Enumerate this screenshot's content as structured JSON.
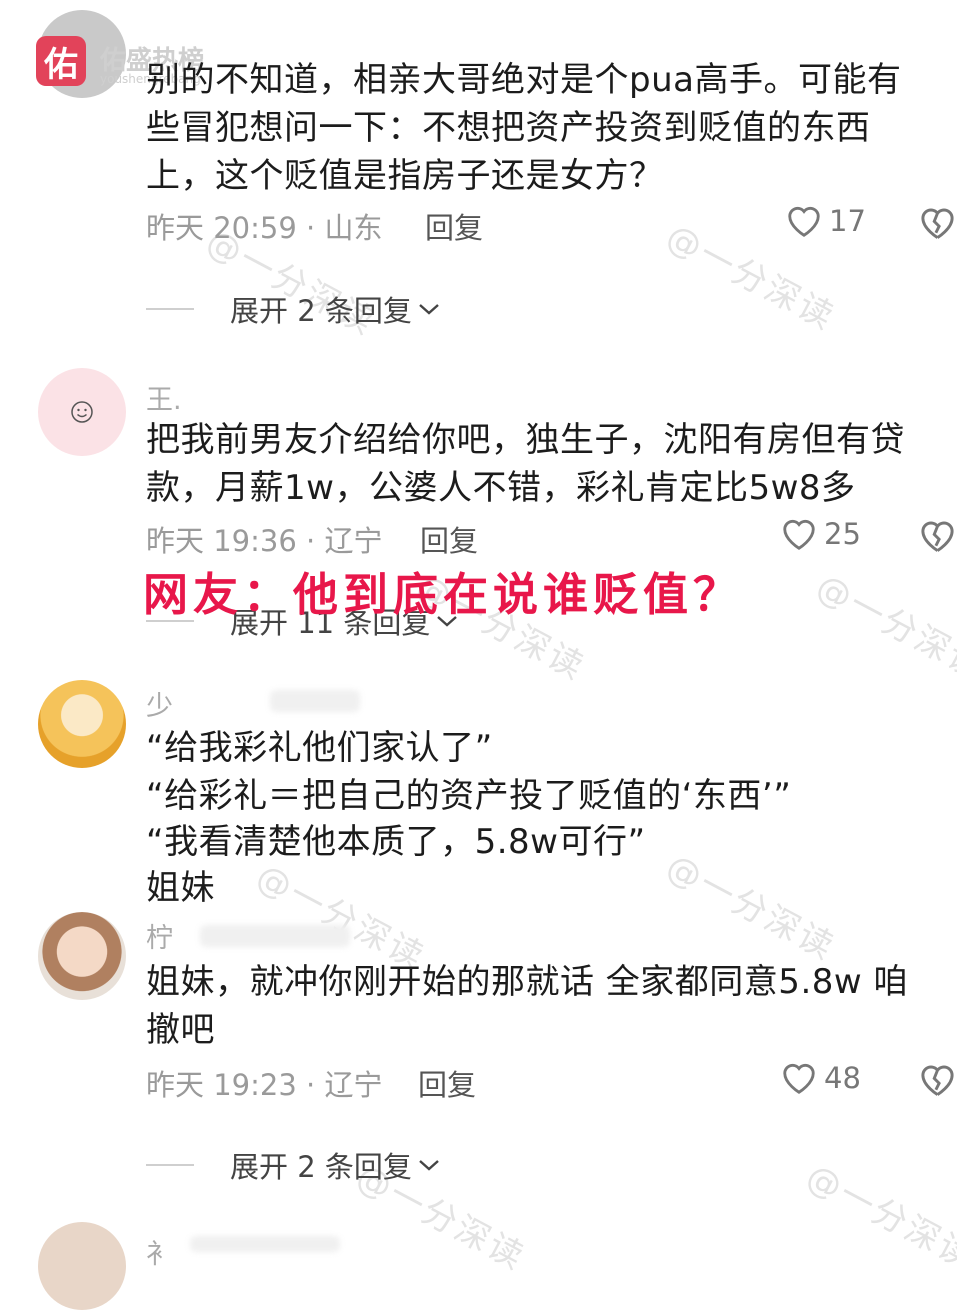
{
  "logo": {
    "text": "佑盛热榜",
    "badge": "佑",
    "url_text": "youshengrebang"
  },
  "watermark": "@一分深读",
  "overlay_caption": "网友：他到底在说谁贬值？",
  "comments": [
    {
      "lines": [
        "别的不知道，相亲大哥绝对是个pua高手。可能有",
        "些冒犯想问一下：不想把资产投资到贬值的东西",
        "上，这个贬值是指房子还是女方？"
      ],
      "meta": "昨天 20:59 · 山东",
      "reply": "回复",
      "likes": "17",
      "expand": "展开 2 条回复"
    },
    {
      "username": "王.",
      "lines": [
        "把我前男友介绍给你吧，独生子，沈阳有房但有贷",
        "款，月薪1w，公婆人不错，彩礼肯定比5w8多"
      ],
      "meta": "昨天 19:36 · 辽宁",
      "reply": "回复",
      "likes": "25",
      "expand": "展开 11 条回复"
    },
    {
      "username": "少",
      "lines": [
        "“给我彩礼他们家认了”",
        "“给彩礼＝把自己的资产投了贬值的‘东西’”",
        "“我看清楚他本质了，5.8w可行”",
        "姐妹"
      ]
    },
    {
      "username": "柠",
      "lines": [
        "姐妹，就冲你刚开始的那就话 全家都同意5.8w 咱",
        "撤吧"
      ],
      "meta": "昨天 19:23 · 辽宁",
      "reply": "回复",
      "likes": "48",
      "expand": "展开 2 条回复"
    },
    {
      "username": "衤"
    }
  ],
  "colors": {
    "caption": "#e8174a",
    "meta": "#9a9a9a",
    "text": "#1c1c1c"
  }
}
